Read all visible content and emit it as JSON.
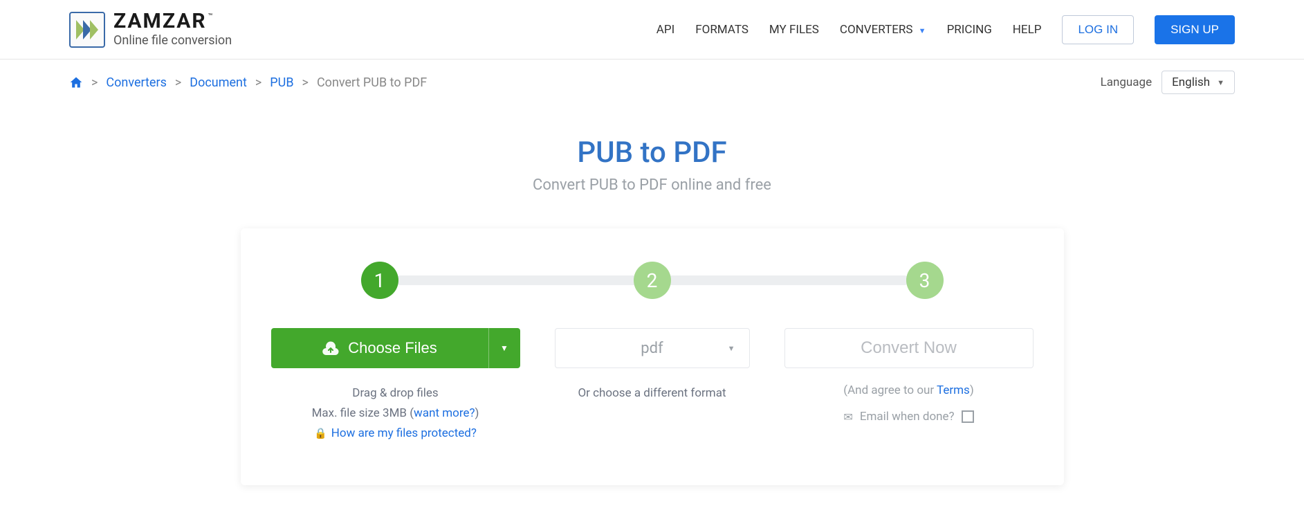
{
  "header": {
    "brand_name": "ZAMZAR",
    "brand_tm": "™",
    "brand_tagline": "Online file conversion",
    "nav": {
      "api": "API",
      "formats": "FORMATS",
      "my_files": "MY FILES",
      "converters": "CONVERTERS",
      "pricing": "PRICING",
      "help": "HELP"
    },
    "login": "LOG IN",
    "signup": "SIGN UP"
  },
  "breadcrumb": {
    "converters": "Converters",
    "document": "Document",
    "pub": "PUB",
    "current": "Convert PUB to PDF"
  },
  "language": {
    "label": "Language",
    "selected": "English"
  },
  "hero": {
    "title": "PUB to PDF",
    "subtitle": "Convert PUB to PDF online and free"
  },
  "steps": {
    "s1": "1",
    "s2": "2",
    "s3": "3"
  },
  "choose": {
    "label": "Choose Files",
    "hint_drag": "Drag & drop files",
    "hint_max_prefix": "Max. file size 3MB (",
    "hint_max_link": "want more?",
    "hint_max_suffix": ")",
    "hint_protect": "How are my files protected?"
  },
  "format": {
    "selected": "pdf",
    "hint": "Or choose a different format"
  },
  "convert": {
    "label": "Convert Now",
    "agree_prefix": "(And agree to our ",
    "agree_link": "Terms",
    "agree_suffix": ")",
    "email_label": "Email when done?"
  }
}
